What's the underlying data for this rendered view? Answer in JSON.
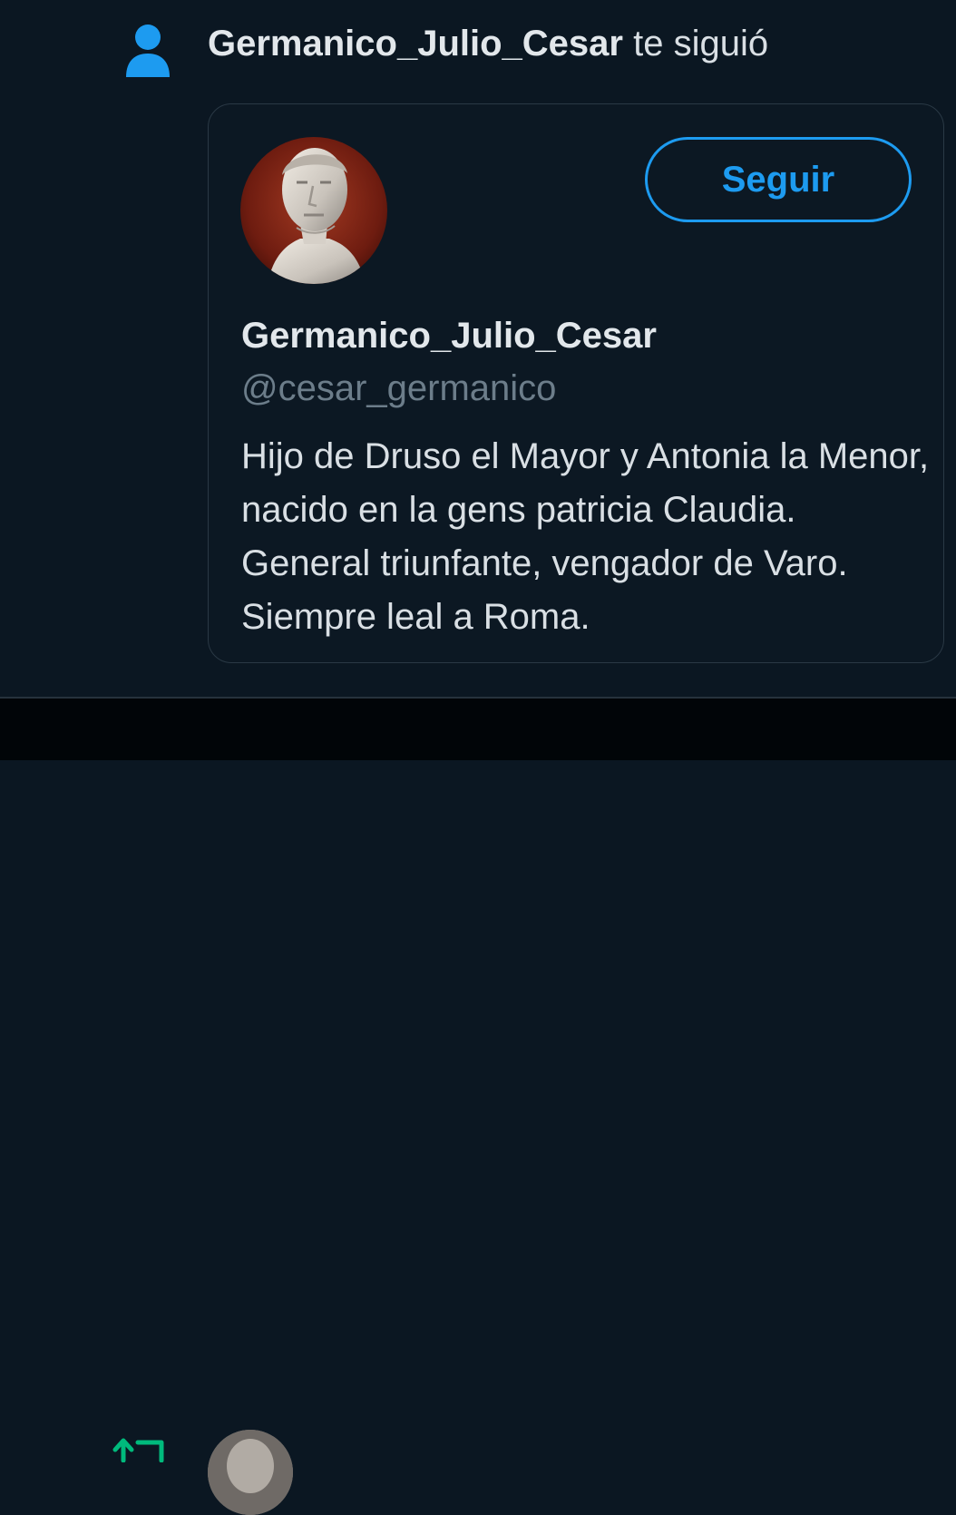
{
  "notification": {
    "icon": "person-icon",
    "username": "Germanico_Julio_Cesar",
    "action_text": "te siguió"
  },
  "profile_card": {
    "display_name": "Germanico_Julio_Cesar",
    "handle": "@cesar_germanico",
    "bio": "Hijo de Druso el Mayor y Antonia la Menor, nacido en la gens patricia Claudia. General triunfante, vengador de Varo. Siempre leal a Roma.",
    "follow_label": "Seguir"
  },
  "next_notification": {
    "icon": "retweet-icon"
  },
  "colors": {
    "background": "#0b1722",
    "accent": "#1d9bf0",
    "retweet_green": "#00ba7c",
    "text_primary": "#e2e7eb",
    "text_secondary": "#6c7d8a"
  }
}
